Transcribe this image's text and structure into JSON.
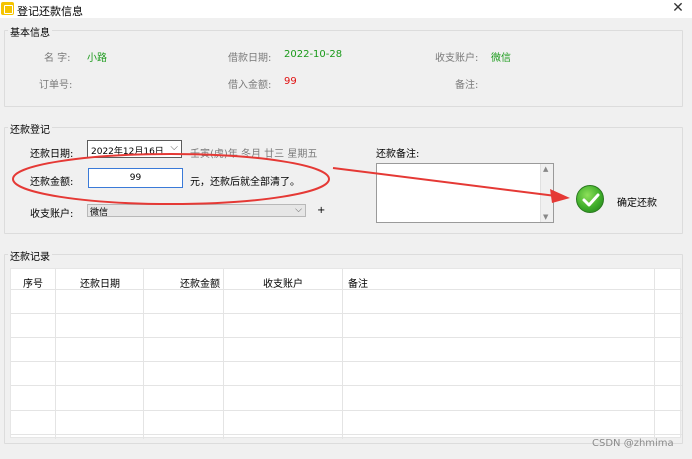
{
  "window": {
    "title": "登记还款信息",
    "close_glyph": "✕"
  },
  "basic_info": {
    "legend": "基本信息",
    "name_label": "名 字:",
    "name_value": "小路",
    "borrow_date_label": "借款日期:",
    "borrow_date_value": "2022-10-28",
    "account_label": "收支账户:",
    "account_value": "微信",
    "order_label": "订单号:",
    "amount_label": "借入金额:",
    "amount_value": "99",
    "note_label": "备注:"
  },
  "repay_register": {
    "legend": "还款登记",
    "date_label": "还款日期:",
    "date_value": "2022年12月16日",
    "lunar_text": "壬寅(虎)年 冬月 廿三 星期五",
    "amount_label": "还款金额:",
    "amount_value": "99",
    "amount_hint": "元，还款后就全部清了。",
    "account_label": "收支账户:",
    "account_value": "微信",
    "plus_glyph": "+",
    "remark_label": "还款备注:",
    "confirm_label": "确定还款"
  },
  "records": {
    "legend": "还款记录",
    "columns": [
      "序号",
      "还款日期",
      "还款金额",
      "收支账户",
      "备注"
    ]
  },
  "watermark": "CSDN @zhmima",
  "colors": {
    "green_value": "#1a9a1a",
    "red_value": "#e01010",
    "annotation": "#e53935"
  }
}
